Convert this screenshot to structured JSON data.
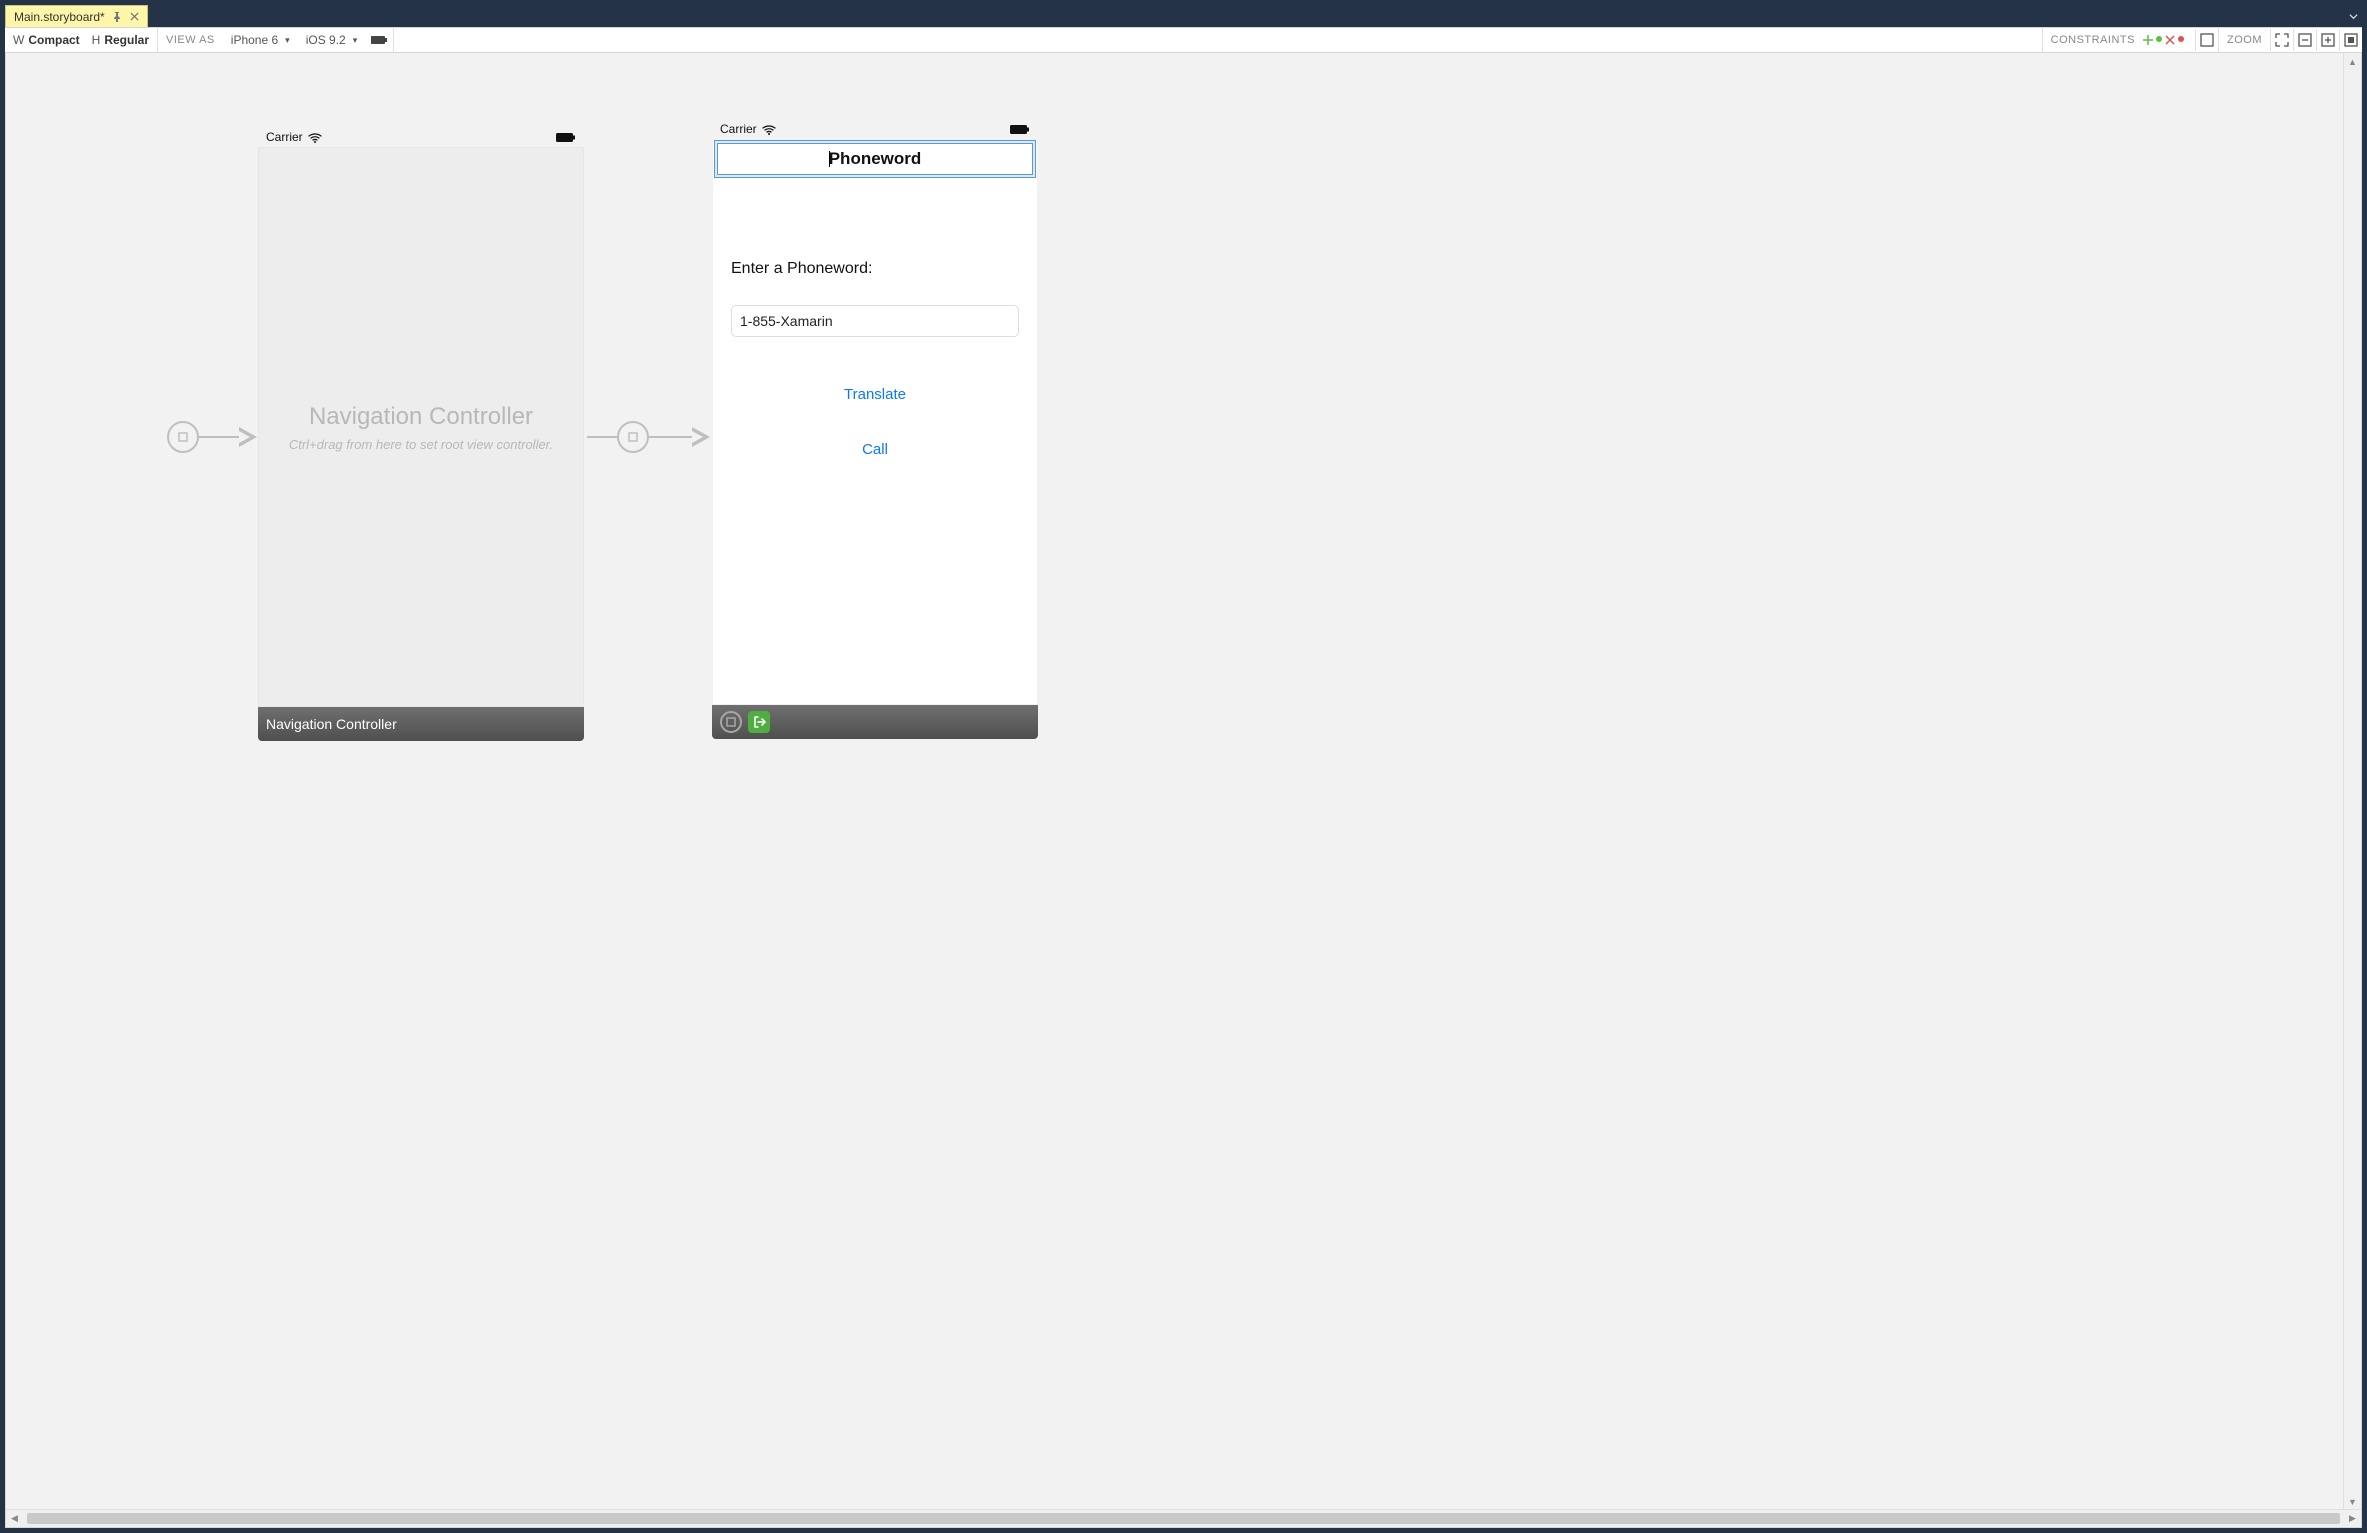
{
  "tab": {
    "title": "Main.storyboard*",
    "pin_icon": "pin-icon",
    "close_icon": "close-icon"
  },
  "toolbar": {
    "size_w_label": "W",
    "size_w_value": "Compact",
    "size_h_label": "H",
    "size_h_value": "Regular",
    "view_as_label": "VIEW AS",
    "device": "iPhone 6",
    "os": "iOS 9.2",
    "constraints_label": "CONSTRAINTS",
    "zoom_label": "ZOOM"
  },
  "nav_scene": {
    "status_carrier": "Carrier",
    "body_title": "Navigation Controller",
    "body_hint": "Ctrl+drag from here to set root view controller.",
    "footer_label": "Navigation Controller"
  },
  "view_scene": {
    "status_carrier": "Carrier",
    "navbar_title": "Phoneword",
    "label": "Enter a Phoneword:",
    "input_value": "1-855-Xamarin",
    "btn_translate": "Translate",
    "btn_call": "Call"
  },
  "colors": {
    "ios_blue": "#0b78ff"
  }
}
